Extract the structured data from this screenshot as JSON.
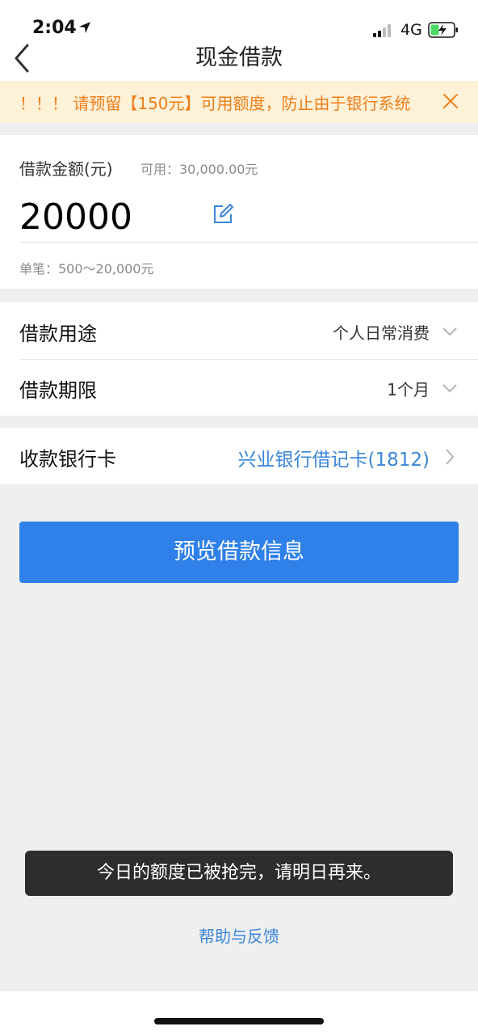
{
  "status_bar": {
    "time": "2:04",
    "network": "4G",
    "icons": [
      "location-arrow-icon",
      "signal-icon",
      "battery-charging-icon"
    ]
  },
  "nav": {
    "title": "现金借款",
    "back_icon": "chevron-left-icon"
  },
  "notice": {
    "text": "！！！ 请预留【150元】可用额度，防止由于银行系统",
    "close_icon": "close-icon",
    "color": "#f07e1c"
  },
  "amount": {
    "label": "借款金额(元)",
    "available": "可用：30,000.00元",
    "value": "20000",
    "edit_icon": "edit-icon",
    "range": "单笔：500～20,000元"
  },
  "rows": {
    "purpose": {
      "label": "借款用途",
      "value": "个人日常消费"
    },
    "term": {
      "label": "借款期限",
      "value": "1个月"
    },
    "bank": {
      "label": "收款银行卡",
      "value": "兴业银行借记卡(1812)"
    }
  },
  "primary_button": {
    "label": "预览借款信息",
    "color": "#2f80e8"
  },
  "toast": {
    "text": "今日的额度已被抢完，请明日再来。"
  },
  "help": {
    "label": "帮助与反馈"
  }
}
